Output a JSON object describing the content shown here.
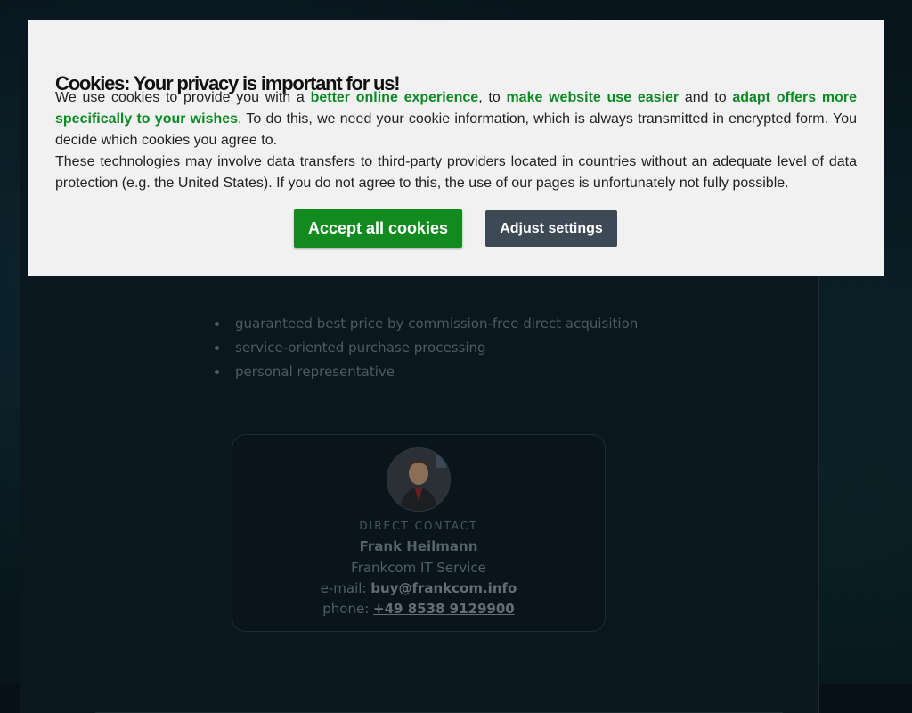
{
  "cookie_banner": {
    "title": "Cookies: Your privacy is important for us!",
    "p1_a": "We use cookies to provide you with a ",
    "p1_hl1": "better online experience",
    "p1_b": ", to ",
    "p1_hl2": "make website use easier",
    "p1_c": " and to ",
    "p1_hl3": "adapt offers more specifically to your wishes",
    "p1_d": ". To do this, we need your cookie information, which is always transmitted in encrypted form. You decide which cookies you agree to.",
    "p2": "These technologies may involve data transfers to third-party providers located in countries without an adequate level of data protection (e.g. the United States). If you do not agree to this, the use of our pages is unfortunately not fully possible.",
    "accept_label": "Accept all cookies",
    "adjust_label": "Adjust settings"
  },
  "benefits": [
    "guaranteed best price by commission-free direct acquisition",
    "service-oriented purchase processing",
    "personal representative"
  ],
  "contact": {
    "label": "DIRECT CONTACT",
    "name": "Frank Heilmann",
    "company": "Frankcom IT Service",
    "email_prefix": "e-mail: ",
    "email": "buy@frankcom.info",
    "phone_prefix": "phone: ",
    "phone": "+49 8538 9129900"
  },
  "colors": {
    "accent_green": "#128a1f",
    "highlight_green": "#0c8a23",
    "secondary_button": "#3d4a55",
    "banner_bg": "#f1f1f1"
  }
}
